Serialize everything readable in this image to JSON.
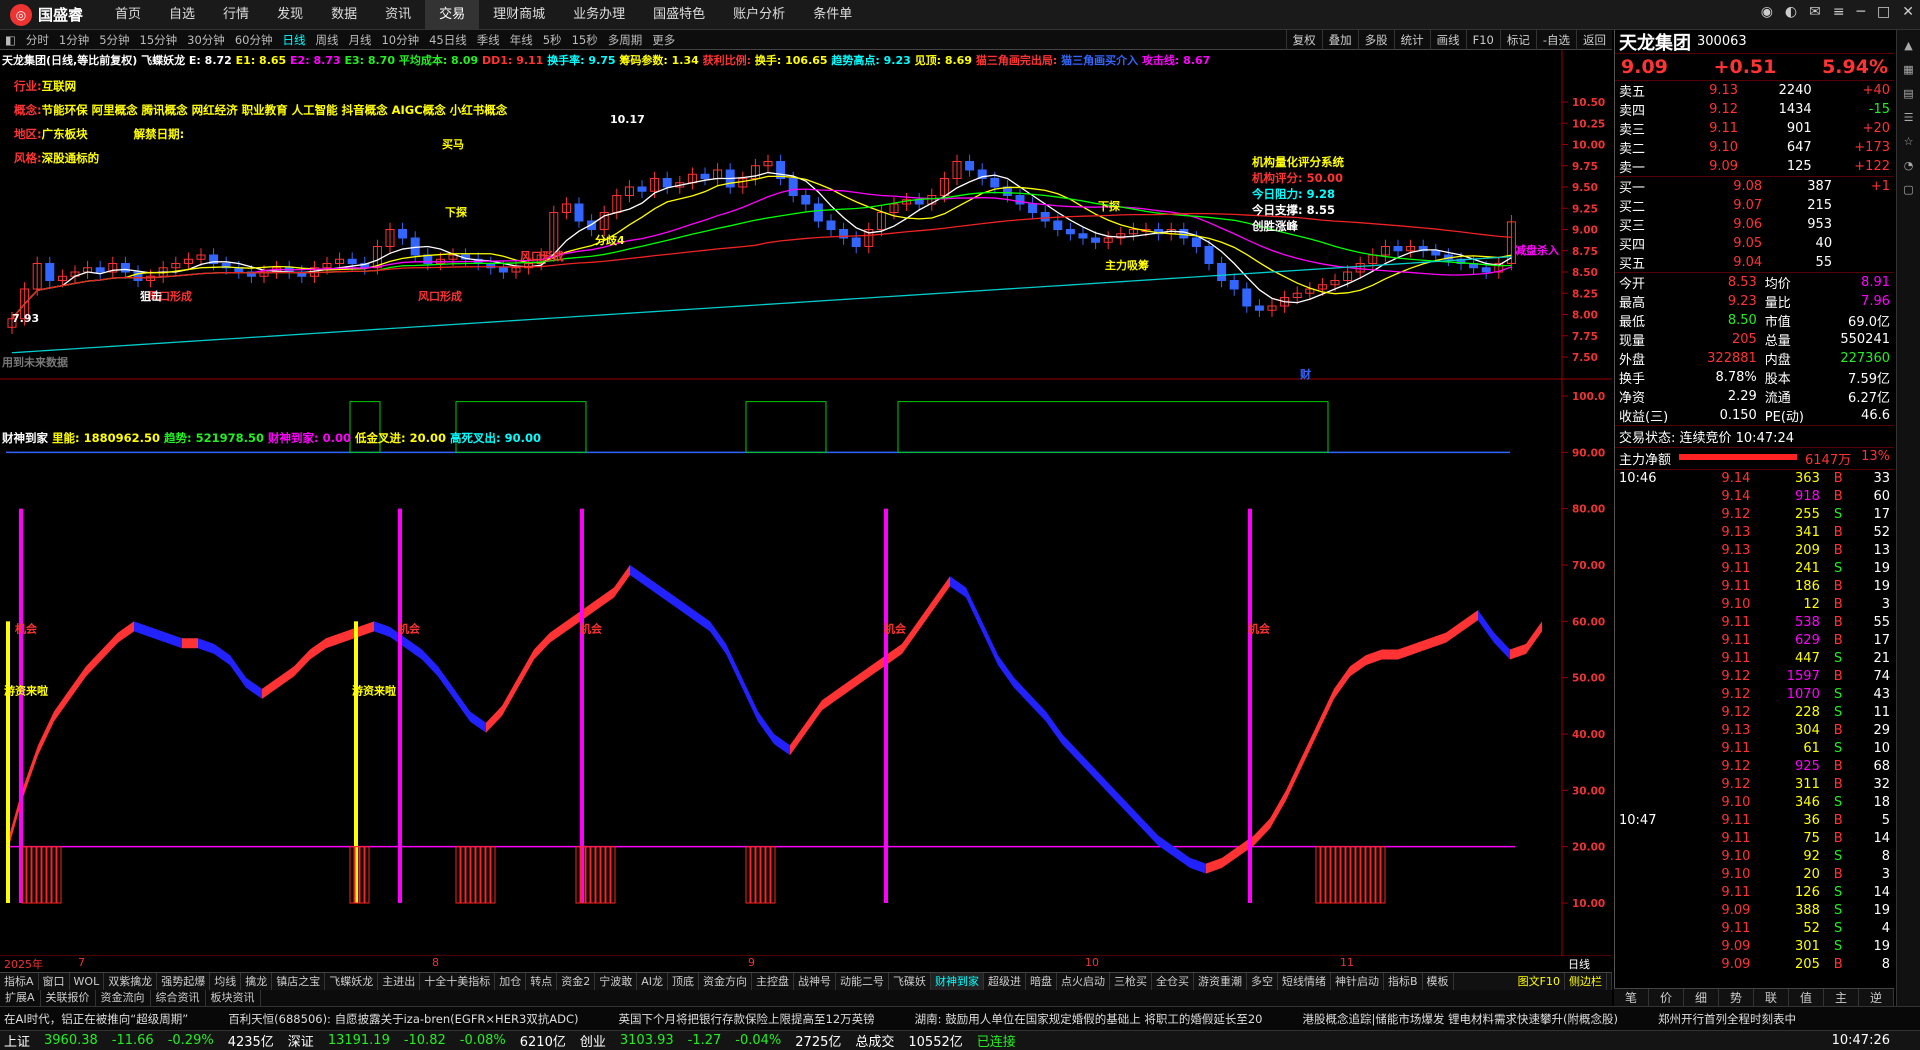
{
  "app": {
    "name": "国盛睿",
    "menu": [
      "首页",
      "自选",
      "行情",
      "发现",
      "数据",
      "资讯",
      "交易",
      "理财商城",
      "业务办理",
      "国盛特色",
      "账户分析",
      "条件单"
    ],
    "active_menu": "交易"
  },
  "periods": {
    "items": [
      "分时",
      "1分钟",
      "5分钟",
      "15分钟",
      "30分钟",
      "60分钟",
      "日线",
      "周线",
      "月线",
      "10分钟",
      "45日线",
      "季线",
      "年线",
      "5秒",
      "15秒",
      "多周期",
      "更多"
    ],
    "active": "日线",
    "right_tools": [
      "复权",
      "叠加",
      "多股",
      "统计",
      "画线",
      "F10",
      "标记",
      "-自选",
      "返回"
    ]
  },
  "main_info": {
    "title": "天龙集团(日线,等比前复权)",
    "ind": "飞蝶妖龙",
    "e": "E: 8.72",
    "e1": "E1: 8.65",
    "e2": "E2: 8.73",
    "e3": "E3: 8.70",
    "avg_cost": "平均成本: 8.09",
    "dd1": "DD1: 9.11",
    "turn": "换手率: 9.75",
    "chip": "筹码参数: 1.34",
    "profit": "获利比例:",
    "hand": "换手: 106.65",
    "peak": "趋势高点: 9.23",
    "top": "见顶: 8.69",
    "tri": "猫三角画完出局:",
    "tri2": "猫三角画买介入",
    "atk": "攻击线: 8.67"
  },
  "stock_meta": {
    "industry_label": "行业:",
    "industry": "互联网",
    "concept_label": "概念:",
    "concepts": "节能环保 阿里概念 腾讯概念 网红经济 职业教育 人工智能 抖音概念 AIGC概念 小红书概念",
    "region_label": "地区:",
    "region": "广东板块",
    "unlock_label": "解禁日期:",
    "style_label": "风格:",
    "style": "深股通标的"
  },
  "rating": {
    "title": "机构量化评分系统",
    "score": "机构评分: 50.00",
    "resist": "今日阻力: 9.28",
    "support": "今日支撑: 8.55",
    "state": "创胜涨峰"
  },
  "annotations": {
    "high": "10.17",
    "low": "7.93",
    "future": "用到未来数据",
    "xia": "下探",
    "fenjie": "分歧4",
    "zhuli": "主力吸筹",
    "dabu": "犹豫",
    "kaima": "买马",
    "fengkou": "风口形成",
    "jiemeng": "狙击",
    "cai": "财",
    "sell_note": "减盘杀入"
  },
  "price_scale": [
    "10.50",
    "10.25",
    "10.00",
    "9.75",
    "9.50",
    "9.25",
    "9.00",
    "8.75",
    "8.50",
    "8.25",
    "8.00",
    "7.75",
    "7.50"
  ],
  "sub_info": {
    "title": "财神到家",
    "l1": "里能: 1880962.50",
    "l2": "趋势: 521978.50",
    "l3": "财神到家: 0.00",
    "l4": "低金叉进: 20.00",
    "l5": "高死叉出: 90.00"
  },
  "sub_scale": [
    "100.0",
    "90.00",
    "80.00",
    "70.00",
    "60.00",
    "50.00",
    "40.00",
    "30.00",
    "20.00",
    "10.00"
  ],
  "sub_labels": {
    "chance": "机会",
    "youzi": "游资来啦"
  },
  "dates": [
    "2025年",
    "7",
    "8",
    "9",
    "10",
    "11"
  ],
  "date_period": "日线",
  "tabs": {
    "items": [
      "指标A",
      "窗口",
      "WOL",
      "双紫擒龙",
      "强势起爆",
      "均线",
      "擒龙",
      "镇店之宝",
      "飞蝶妖龙",
      "主进出",
      "十全十美指标",
      "加仓",
      "转点",
      "资金2",
      "宁波敢",
      "AI龙",
      "顶底",
      "资金方向",
      "主控盘",
      "战神号",
      "动能二号",
      "飞碟妖",
      "财神到家",
      "超级进",
      "暗盘",
      "点火启动",
      "三枪买",
      "全仓买",
      "游资重潮",
      "多空",
      "短线情绪",
      "神针启动",
      "指标B",
      "模板"
    ],
    "active": "财神到家",
    "right": [
      "图文F10",
      "侧边栏"
    ]
  },
  "subtabs": [
    "扩展A",
    "关联报价",
    "资金流向",
    "综合资讯",
    "板块资讯"
  ],
  "quote": {
    "name": "天龙集团",
    "code": "300063",
    "price": "9.09",
    "chg": "+0.51",
    "pct": "5.94%",
    "asks": [
      {
        "l": "卖五",
        "p": "9.13",
        "v": "2240",
        "d": "+40"
      },
      {
        "l": "卖四",
        "p": "9.12",
        "v": "1434",
        "d": "-15"
      },
      {
        "l": "卖三",
        "p": "9.11",
        "v": "901",
        "d": "+20"
      },
      {
        "l": "卖二",
        "p": "9.10",
        "v": "647",
        "d": "+173"
      },
      {
        "l": "卖一",
        "p": "9.09",
        "v": "125",
        "d": "+122"
      }
    ],
    "bids": [
      {
        "l": "买一",
        "p": "9.08",
        "v": "387",
        "d": "+1"
      },
      {
        "l": "买二",
        "p": "9.07",
        "v": "215",
        "d": ""
      },
      {
        "l": "买三",
        "p": "9.06",
        "v": "953",
        "d": ""
      },
      {
        "l": "买四",
        "p": "9.05",
        "v": "40",
        "d": ""
      },
      {
        "l": "买五",
        "p": "9.04",
        "v": "55",
        "d": ""
      }
    ],
    "stats": [
      [
        "今开",
        "8.53",
        "均价",
        "8.91"
      ],
      [
        "最高",
        "9.23",
        "量比",
        "7.96"
      ],
      [
        "最低",
        "8.50",
        "市值",
        "69.0亿"
      ],
      [
        "现量",
        "205",
        "总量",
        "550241"
      ],
      [
        "外盘",
        "322881",
        "内盘",
        "227360"
      ],
      [
        "换手",
        "8.78%",
        "股本",
        "7.59亿"
      ],
      [
        "净资",
        "2.29",
        "流通",
        "6.27亿"
      ],
      [
        "收益(三)",
        "0.150",
        "PE(动)",
        "46.6"
      ]
    ],
    "state": "交易状态: 连续竞价 10:47:24",
    "net_label": "主力净额",
    "net_val": "6147万",
    "net_pct": "13%"
  },
  "ticks_a": {
    "time": "10:46",
    "rows": [
      [
        "9.14",
        "363",
        "B",
        "33"
      ],
      [
        "9.14",
        "918",
        "B",
        "60"
      ],
      [
        "9.12",
        "255",
        "S",
        "17"
      ],
      [
        "9.13",
        "341",
        "B",
        "52"
      ],
      [
        "9.13",
        "209",
        "B",
        "13"
      ],
      [
        "9.11",
        "241",
        "S",
        "19"
      ],
      [
        "9.11",
        "186",
        "B",
        "19"
      ],
      [
        "9.10",
        "12",
        "B",
        "3"
      ],
      [
        "9.11",
        "538",
        "B",
        "55"
      ],
      [
        "9.11",
        "629",
        "B",
        "17"
      ],
      [
        "9.11",
        "447",
        "S",
        "21"
      ],
      [
        "9.12",
        "1597",
        "B",
        "74"
      ],
      [
        "9.12",
        "1070",
        "S",
        "43"
      ],
      [
        "9.12",
        "228",
        "S",
        "11"
      ],
      [
        "9.13",
        "304",
        "B",
        "29"
      ],
      [
        "9.11",
        "61",
        "S",
        "10"
      ],
      [
        "9.12",
        "925",
        "B",
        "68"
      ],
      [
        "9.12",
        "311",
        "B",
        "32"
      ],
      [
        "9.10",
        "346",
        "S",
        "18"
      ]
    ]
  },
  "ticks_b": {
    "time": "10:47",
    "rows": [
      [
        "9.11",
        "36",
        "B",
        "5"
      ],
      [
        "9.11",
        "75",
        "B",
        "14"
      ],
      [
        "9.10",
        "92",
        "S",
        "8"
      ],
      [
        "9.10",
        "20",
        "B",
        "3"
      ],
      [
        "9.11",
        "126",
        "S",
        "14"
      ],
      [
        "9.09",
        "388",
        "S",
        "19"
      ],
      [
        "9.11",
        "52",
        "S",
        "4"
      ],
      [
        "9.09",
        "301",
        "S",
        "19"
      ],
      [
        "9.09",
        "205",
        "B",
        "8"
      ]
    ]
  },
  "right_tabs": [
    "笔",
    "价",
    "细",
    "势",
    "联",
    "值",
    "主",
    "逆"
  ],
  "side_icons": [
    "arrow-up-icon",
    "grid-icon",
    "chart-icon",
    "list-icon",
    "star-icon",
    "bell-icon",
    "doc-icon"
  ],
  "ticker": [
    "在AI时代，铝正在被推向“超级周期”",
    "百利天恒(688506): 自愿披露关于iza-bren(EGFR×HER3双抗ADC)",
    "英国下个月将把银行存款保险上限提高至12万英镑",
    "湖南: 鼓励用人单位在国家规定婚假的基础上 将职工的婚假延长至20",
    "港股概念追踪|储能市场爆发 锂电材料需求快速攀升(附概念股)",
    "郑州开行首列全程时刻表中"
  ],
  "status": {
    "sh": "上证",
    "sh_v": "3960.38",
    "sh_c": "-11.66",
    "sh_p": "-0.29%",
    "sh_a": "4235亿",
    "sz": "深证",
    "sz_v": "13191.19",
    "sz_c": "-10.82",
    "sz_p": "-0.08%",
    "sz_a": "6210亿",
    "cy": "创业",
    "cy_v": "3103.93",
    "cy_c": "-1.27",
    "cy_p": "-0.04%",
    "cy_a": "2725亿",
    "total": "总成交",
    "total_v": "10552亿",
    "conn": "已连接",
    "time": "10:47:26"
  }
}
